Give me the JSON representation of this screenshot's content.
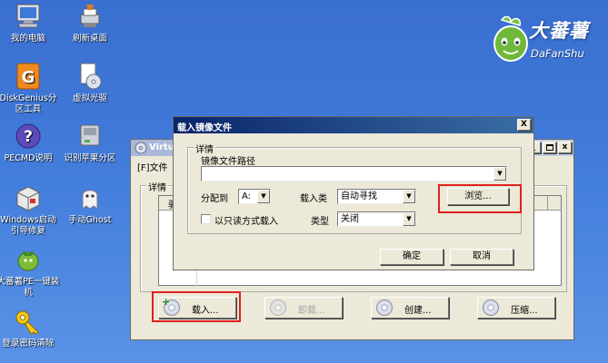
{
  "desktop": {
    "icons": [
      {
        "label": "我的电脑",
        "icon": "computer-icon"
      },
      {
        "label": "刷新桌面",
        "icon": "refresh-desktop-icon"
      },
      {
        "label": "DiskGenius分区工具",
        "icon": "diskgenius-icon"
      },
      {
        "label": "虚拟光驱",
        "icon": "virtual-drive-icon"
      },
      {
        "label": "PECMD说明",
        "icon": "help-icon"
      },
      {
        "label": "识别苹果分区",
        "icon": "disk-icon"
      },
      {
        "label": "Windows启动引导修复",
        "icon": "boot-repair-icon"
      },
      {
        "label": "手动Ghost",
        "icon": "ghost-icon"
      },
      {
        "label": "大蕃薯PE一键装机",
        "icon": "installer-icon"
      },
      {
        "label": "登录密码清除",
        "icon": "key-icon"
      }
    ]
  },
  "logo": {
    "cn": "大蕃薯",
    "en": "DaFanShu"
  },
  "back_window": {
    "title": "Virtua",
    "menu_file": "[F]文件",
    "group_label": "详情",
    "col_first": "驱",
    "buttons": {
      "load": "载入...",
      "unload": "卸载...",
      "create": "创建...",
      "compress": "压缩..."
    }
  },
  "dialog": {
    "title": "载入镜像文件",
    "close_glyph": "X",
    "group_label": "详情",
    "path_label": "镜像文件路径",
    "path_value": "",
    "assign_label": "分配到",
    "assign_value": "A:",
    "load_type_label": "载入类",
    "load_type_value": "自动寻找",
    "browse_label": "浏览...",
    "readonly_label": "以只读方式载入",
    "type_label": "类型",
    "type_value": "关闭",
    "ok_label": "确定",
    "cancel_label": "取消"
  },
  "colors": {
    "highlight": "#e0201c",
    "caption_active": "#0a246a",
    "caption_inactive": "#7a96df"
  }
}
